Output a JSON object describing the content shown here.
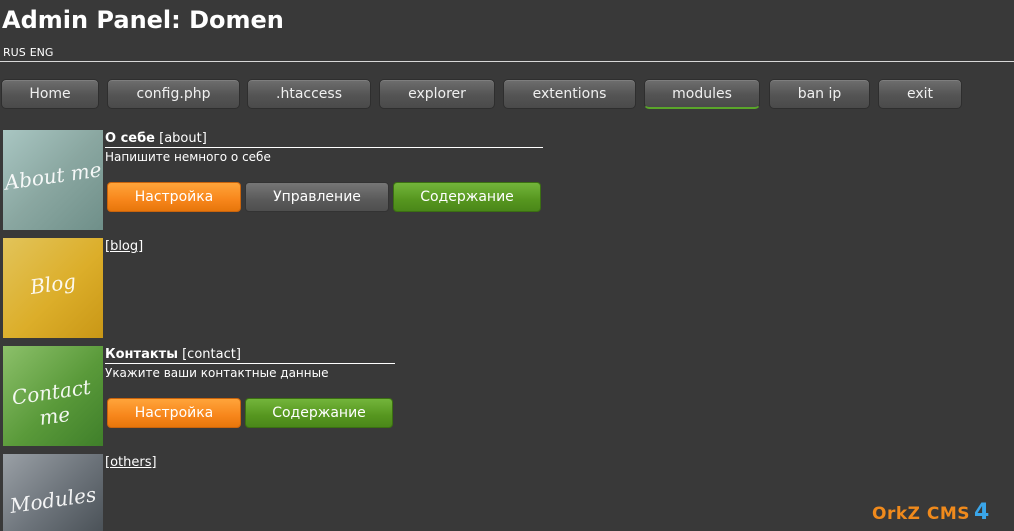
{
  "header": {
    "title": "Admin Panel: Domen"
  },
  "languages": [
    "RUS",
    "ENG"
  ],
  "nav": [
    {
      "label": "Home"
    },
    {
      "label": "config.php"
    },
    {
      "label": ".htaccess"
    },
    {
      "label": "explorer"
    },
    {
      "label": "extentions"
    },
    {
      "label": "modules",
      "active": true
    },
    {
      "label": "ban ip"
    },
    {
      "label": "exit"
    }
  ],
  "modules": [
    {
      "title": "О себе",
      "key": "[about]",
      "description": "Напишите немного о себе",
      "thumb_text": "About me",
      "buttons": [
        "Настройка",
        "Управление",
        "Содержание"
      ]
    },
    {
      "title": "",
      "key": "[blog]",
      "description": "",
      "thumb_text": "Blog",
      "buttons": []
    },
    {
      "title": "Контакты",
      "key": "[contact]",
      "description": "Укажите ваши контактные данные",
      "thumb_text": "Contact me",
      "buttons": [
        "Настройка",
        "Содержание"
      ]
    },
    {
      "title": "",
      "key": "[others]",
      "description": "",
      "thumb_text": "Modules",
      "buttons": []
    }
  ],
  "footer": {
    "logo_text": "OrkZ CMS",
    "logo_version": "4"
  },
  "colors": {
    "background": "#393939",
    "orange": "#f7861b",
    "green": "#56961f",
    "gray": "#5a5a5a"
  }
}
